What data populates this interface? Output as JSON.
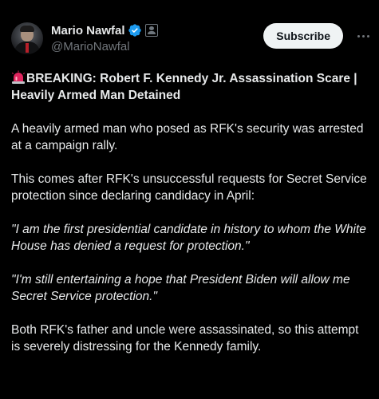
{
  "author": {
    "display_name": "Mario Nawfal",
    "handle": "@MarioNawfal",
    "verified": true,
    "verified_color": "#1d9bf0"
  },
  "actions": {
    "subscribe_label": "Subscribe",
    "more_icon": "more-horizontal-icon"
  },
  "post": {
    "headline_icon": "siren-icon",
    "headline": "BREAKING: Robert F. Kennedy Jr. Assassination Scare | Heavily Armed Man Detained",
    "paragraph_1": "A heavily armed man who posed as RFK's security was arrested at a campaign rally.",
    "paragraph_2": "This comes after RFK's unsuccessful requests for Secret Service protection since declaring candidacy in April:",
    "quote_1": "\"I am the first presidential candidate in history to whom the White House has denied a request for protection.\"",
    "quote_2": "\"I'm still entertaining a hope that President Biden will allow me Secret Service protection.\"",
    "paragraph_3": "Both RFK's father and uncle were assassinated, so this attempt is severely distressing for the Kennedy family."
  },
  "colors": {
    "background": "#000000",
    "text": "#e7e9ea",
    "secondary_text": "#71767b",
    "button_bg": "#eff3f4",
    "button_text": "#0f1419",
    "siren_red": "#e0245e"
  }
}
